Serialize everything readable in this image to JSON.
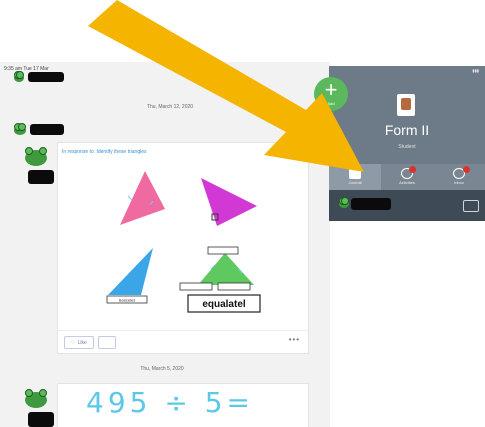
{
  "status_bar": "9:35 am  Tue 17 Mar",
  "feed": {
    "dates": [
      "Thu, March 12, 2020",
      "Thu, March 5, 2020"
    ],
    "post1": {
      "prompt": "In response to: Identify these triangles",
      "labels": [
        "isosceles",
        "equalatel"
      ],
      "like_label": "Like"
    },
    "post2": {
      "handwriting": "495 ÷ 5="
    }
  },
  "panel": {
    "class_name": "Form II",
    "role": "Student",
    "tabs": [
      {
        "label": "Journal",
        "icon": "journal-icon"
      },
      {
        "label": "Activities",
        "icon": "activities-icon"
      },
      {
        "label": "Inbox",
        "icon": "inbox-icon"
      }
    ]
  },
  "add_button": {
    "label": "Add"
  },
  "colors": {
    "arrow": "#f4b400",
    "panel": "#6d7a87",
    "add": "#5cb85c"
  }
}
